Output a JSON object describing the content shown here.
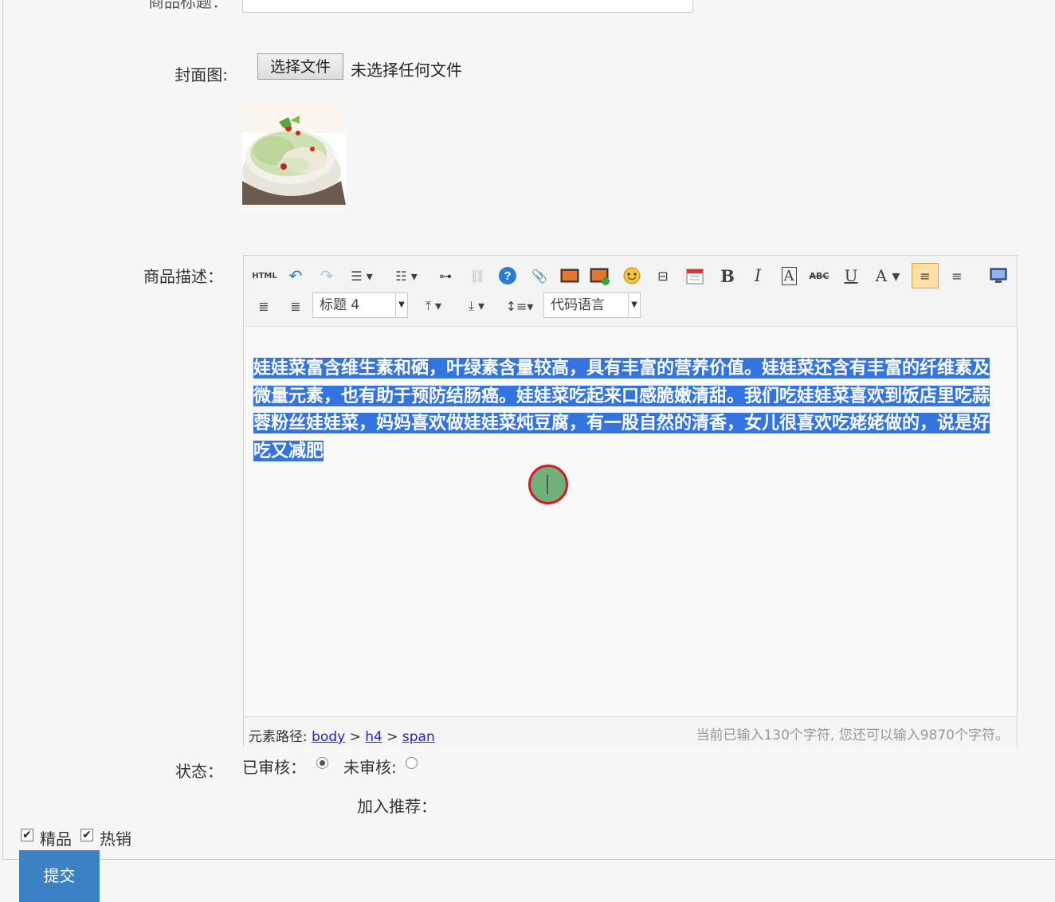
{
  "form": {
    "top_field_label": "商品标题：",
    "cover_label": "封面图:",
    "file_button": "选择文件",
    "file_status": "未选择任何文件",
    "description_label": "商品描述：",
    "status_label": "状态：",
    "audited_label": "已审核：",
    "unaudited_label": "未审核:",
    "recommend_label": "加入推荐：",
    "featured_label": "精品",
    "hot_label": "热销",
    "submit_label": "提交"
  },
  "editor": {
    "toolbar": {
      "html_label": "HTML",
      "heading_value": "标题 4",
      "code_lang_value": "代码语言",
      "icons": [
        "html-source-icon",
        "undo-icon",
        "redo-icon",
        "unordered-list-icon",
        "ordered-list-icon",
        "link-icon",
        "unlink-icon",
        "help-icon",
        "attachment-icon",
        "image-icon",
        "multi-image-icon",
        "emoticon-icon",
        "page-break-icon",
        "date-icon",
        "bold-icon",
        "italic-icon",
        "text-box-icon",
        "strikethrough-icon",
        "underline-icon",
        "font-color-icon",
        "align-left-icon",
        "align-center-icon",
        "fullscreen-icon",
        "align-right-icon",
        "justify-icon",
        "para-before-icon",
        "para-after-icon",
        "line-height-icon"
      ]
    },
    "content": "娃娃菜富含维生素和硒，叶绿素含量较高，具有丰富的营养价值。娃娃菜还含有丰富的纤维素及微量元素，也有助于预防结肠癌。娃娃菜吃起来口感脆嫩清甜。我们吃娃娃菜喜欢到饭店里吃蒜蓉粉丝娃娃菜，妈妈喜欢做娃娃菜炖豆腐，有一股自然的清香，女儿很喜欢吃姥姥做的，说是好吃又减肥",
    "status": {
      "path_label": "元素路径:",
      "path": [
        "body",
        "h4",
        "span"
      ],
      "path_sep": ">",
      "count_text": "当前已输入130个字符, 您还可以输入9870个字符。"
    }
  },
  "colors": {
    "selection": "#3374e0",
    "submit": "#3a82c4",
    "active_tool": "#fbe1a8"
  }
}
